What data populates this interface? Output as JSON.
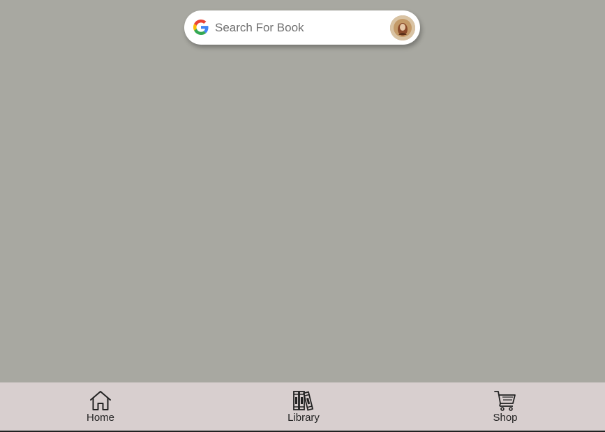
{
  "search": {
    "placeholder": "Search For Book",
    "value": ""
  },
  "nav": {
    "home_label": "Home",
    "library_label": "Library",
    "shop_label": "Shop"
  },
  "icons": {
    "search_provider": "google-g-icon",
    "avatar": "user-avatar",
    "home": "home-icon",
    "library": "books-icon",
    "shop": "shopping-cart-icon"
  },
  "colors": {
    "background": "#a8a8a1",
    "nav_background": "#d8cfcf",
    "search_background": "#ffffff"
  }
}
